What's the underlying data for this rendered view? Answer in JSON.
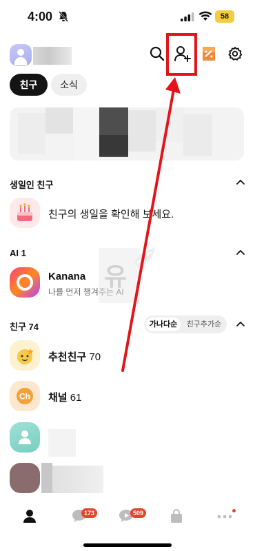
{
  "status": {
    "time": "4:00",
    "battery": "58"
  },
  "header": {
    "icons": [
      "search-icon",
      "add-friend-icon",
      "gift-icon",
      "settings-icon"
    ]
  },
  "tabs": [
    {
      "label": "친구",
      "active": true
    },
    {
      "label": "소식",
      "active": false
    }
  ],
  "sections": {
    "birthday": {
      "title": "생일인 친구",
      "row_text": "친구의 생일을 확인해 보세요."
    },
    "ai": {
      "title": "AI 1",
      "name": "Kanana",
      "subtitle": "나를 먼저 챙겨주는 AI"
    },
    "friends": {
      "title": "친구 74",
      "sort_options": [
        "가나다순",
        "친구추가순"
      ],
      "recommended": {
        "label": "추천친구",
        "count": "70"
      },
      "channel": {
        "label": "채널",
        "count": "61"
      },
      "channel_icon_text": "Ch"
    }
  },
  "bottom_nav": {
    "items": [
      "friends-icon",
      "chat-icon",
      "openchat-icon",
      "shopping-icon",
      "more-icon"
    ],
    "chat_badge": "173",
    "openchat_badge": "509"
  },
  "colors": {
    "annotation": "#e3141a",
    "badge": "#e8432e",
    "accent_active": "#141414"
  }
}
